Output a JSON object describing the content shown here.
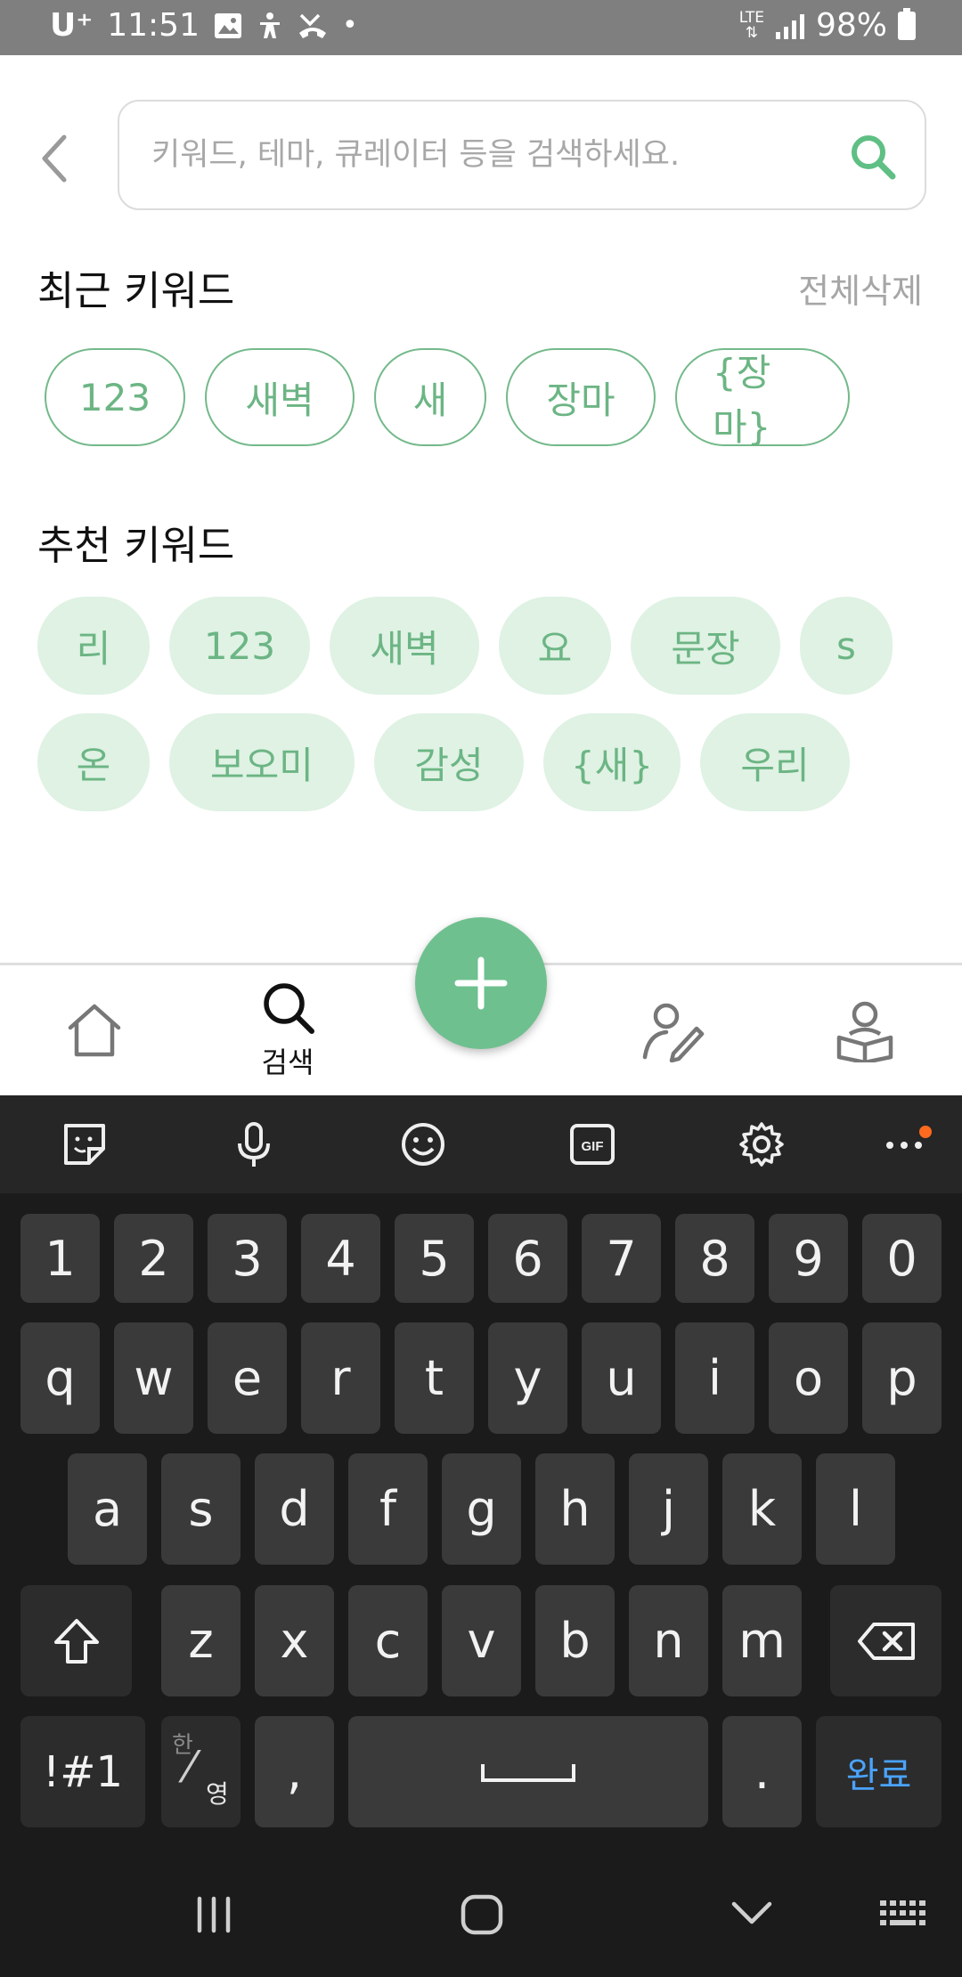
{
  "status_bar": {
    "carrier": "U⁺",
    "time": "11:51",
    "network": "LTE",
    "battery": "98%"
  },
  "search": {
    "placeholder": "키워드, 테마, 큐레이터 등을 검색하세요.",
    "value": ""
  },
  "recent": {
    "title": "최근 키워드",
    "clear_all": "전체삭제",
    "keywords": [
      "123",
      "새벽",
      "새",
      "장마",
      "{장마}"
    ]
  },
  "recommended": {
    "title": "추천 키워드",
    "row1": [
      "리",
      "123",
      "새벽",
      "요",
      "문장",
      "s"
    ],
    "row2": [
      "온",
      "보오미",
      "감성",
      "{새}",
      "우리"
    ]
  },
  "bottom_nav": {
    "active": "search",
    "search_label": "검색"
  },
  "keyboard": {
    "numbers": [
      "1",
      "2",
      "3",
      "4",
      "5",
      "6",
      "7",
      "8",
      "9",
      "0"
    ],
    "row1": [
      "q",
      "w",
      "e",
      "r",
      "t",
      "y",
      "u",
      "i",
      "o",
      "p"
    ],
    "row2": [
      "a",
      "s",
      "d",
      "f",
      "g",
      "h",
      "j",
      "k",
      "l"
    ],
    "row3": [
      "z",
      "x",
      "c",
      "v",
      "b",
      "n",
      "m"
    ],
    "symbol_key": "!#1",
    "lang_top": "한",
    "lang_bottom": "영",
    "comma": ",",
    "period": ".",
    "done": "완료"
  },
  "colors": {
    "accent": "#6fc08f",
    "chip_text": "#6cb584",
    "chip_fill": "#dff2e4",
    "keyboard_bg": "#1b1b1b",
    "key_bg": "#3a3a3a"
  }
}
